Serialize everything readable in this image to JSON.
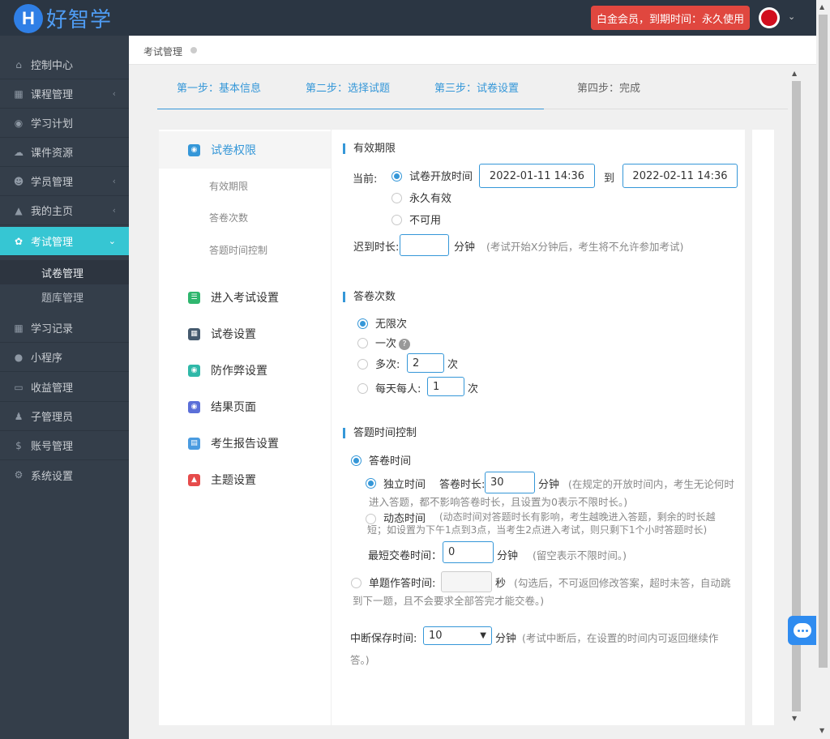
{
  "header": {
    "logo_letter": "H",
    "logo_text": "好智学",
    "member_badge": "白金会员，到期时间：永久使用"
  },
  "sidebar": {
    "items": [
      {
        "label": "控制中心",
        "icon": "home-icon"
      },
      {
        "label": "课程管理",
        "icon": "book-icon",
        "arrow": true
      },
      {
        "label": "学习计划",
        "icon": "eye-icon"
      },
      {
        "label": "课件资源",
        "icon": "cloud-icon"
      },
      {
        "label": "学员管理",
        "icon": "users-icon",
        "arrow": true
      },
      {
        "label": "我的主页",
        "icon": "graduation-cap-icon",
        "arrow": true
      },
      {
        "label": "考试管理",
        "icon": "tag-icon",
        "active": true
      }
    ],
    "sub_items": [
      "试卷管理",
      "题库管理"
    ],
    "items_after": [
      {
        "label": "学习记录",
        "icon": "book-icon"
      },
      {
        "label": "小程序",
        "icon": "chat-icon"
      },
      {
        "label": "收益管理",
        "icon": "card-icon"
      },
      {
        "label": "子管理员",
        "icon": "user-icon"
      },
      {
        "label": "账号管理",
        "icon": "dollar-icon"
      },
      {
        "label": "系统设置",
        "icon": "gear-icon"
      }
    ]
  },
  "breadcrumb": {
    "label": "考试管理"
  },
  "steps": [
    "第一步：基本信息",
    "第二步：选择试题",
    "第三步：试卷设置",
    "第四步：完成"
  ],
  "left_menu": {
    "items": [
      {
        "label": "试卷权限",
        "color": "#3597d8"
      },
      {
        "label": "进入考试设置",
        "color": "#2fb66e"
      },
      {
        "label": "试卷设置",
        "color": "#455a6e"
      },
      {
        "label": "防作弊设置",
        "color": "#2fb8a8"
      },
      {
        "label": "结果页面",
        "color": "#5b6fd8"
      },
      {
        "label": "考生报告设置",
        "color": "#4a9be0"
      },
      {
        "label": "主题设置",
        "color": "#e64b4b"
      }
    ],
    "sub_items": [
      "有效期限",
      "答卷次数",
      "答题时间控制"
    ]
  },
  "validity": {
    "title": "有效期限",
    "current_label": "当前:",
    "opt_open_time": "试卷开放时间",
    "start": "2022-01-11 14:36",
    "to": "到",
    "end": "2022-02-11 14:36",
    "opt_forever": "永久有效",
    "opt_unavailable": "不可用",
    "late_label": "迟到时长:",
    "late_value": "",
    "late_unit": "分钟",
    "late_hint": "(考试开始X分钟后，考生将不允许参加考试)"
  },
  "attempts": {
    "title": "答卷次数",
    "unlimited": "无限次",
    "once": "一次",
    "multi": "多次:",
    "multi_value": "2",
    "multi_unit": "次",
    "daily": "每天每人:",
    "daily_value": "1",
    "daily_unit": "次"
  },
  "timing": {
    "title": "答题时间控制",
    "exam_time": "答卷时间",
    "independent": "独立时间",
    "duration_label": "答卷时长:",
    "duration_value": "30",
    "duration_unit": "分钟",
    "independent_hint_1": "(在规定的开放时间内，考生无论何时",
    "independent_hint_2": "进入答题，都不影响答卷时长，且设置为0表示不限时长。)",
    "dynamic": "动态时间",
    "dynamic_hint_1": "(动态时间对答题时长有影响，考生越晚进入答题，剩余的时长越",
    "dynamic_hint_2": "短；如设置为下午1点到3点，当考生2点进入考试，则只剩下1个小时答题时长)",
    "min_submit_label": "最短交卷时间：",
    "min_submit_value": "0",
    "min_submit_unit": "分钟",
    "min_submit_hint": "(留空表示不限时间。)",
    "per_question_label": "单题作答时间:",
    "per_question_value": "",
    "per_question_unit": "秒",
    "per_question_hint_1": "(勾选后，不可返回修改答案，超时未答，自动跳",
    "per_question_hint_2": "到下一题，且不会要求全部答完才能交卷。)",
    "resume_label": "中断保存时间:",
    "resume_value": "10",
    "resume_unit": "分钟",
    "resume_hint_1": "(考试中断后，在设置的时间内可返回继续作",
    "resume_hint_2": "答。)"
  }
}
